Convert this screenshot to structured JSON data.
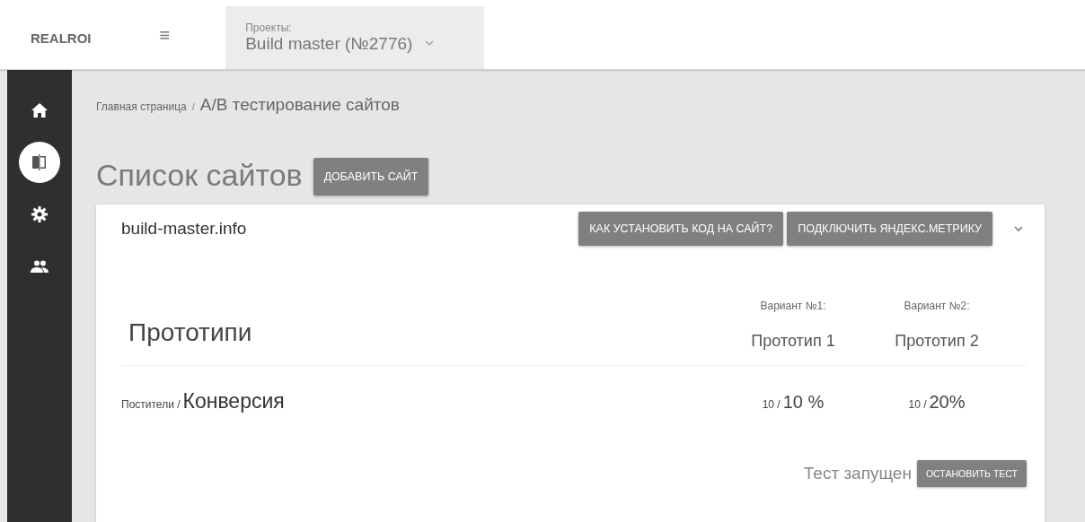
{
  "header": {
    "logo": "REALROI",
    "menu_icon": "≡",
    "project": {
      "label": "Проекты:",
      "value": "Build master (№2776)"
    }
  },
  "sidebar": {
    "items": [
      {
        "kind": "home",
        "selected": false
      },
      {
        "kind": "compare",
        "selected": true
      },
      {
        "kind": "settings",
        "selected": false
      },
      {
        "kind": "users",
        "selected": false
      }
    ]
  },
  "breadcrumb": {
    "items": [
      "Главная страница"
    ],
    "separator": "/",
    "current": "A/B тестирование сайтов"
  },
  "page_title": "Список сайтов",
  "add_button": "ДОБАВИТЬ САЙТ",
  "site_card": {
    "site": "build-master.info",
    "buttons": [
      "КАК УСТАНОВИТЬ КОД НА САЙТ?",
      "ПОДКЛЮЧИТЬ ЯНДЕКС.МЕТРИКУ"
    ],
    "expanded": true,
    "heading": "Прототипи",
    "variants": [
      {
        "label": "Вариант №1:",
        "name": "Прототип 1"
      },
      {
        "label": "Вариант №2:",
        "name": "Прототип 2"
      }
    ],
    "row": {
      "small_label": "Постители /",
      "label": "Конверсия",
      "values": [
        {
          "count": "10 /",
          "rate": "10 %"
        },
        {
          "count": "10 /",
          "rate": "20%"
        }
      ]
    },
    "status": "Тест запущен",
    "stop_button": "ОСТАНОВИТЬ ТЕСТ"
  }
}
